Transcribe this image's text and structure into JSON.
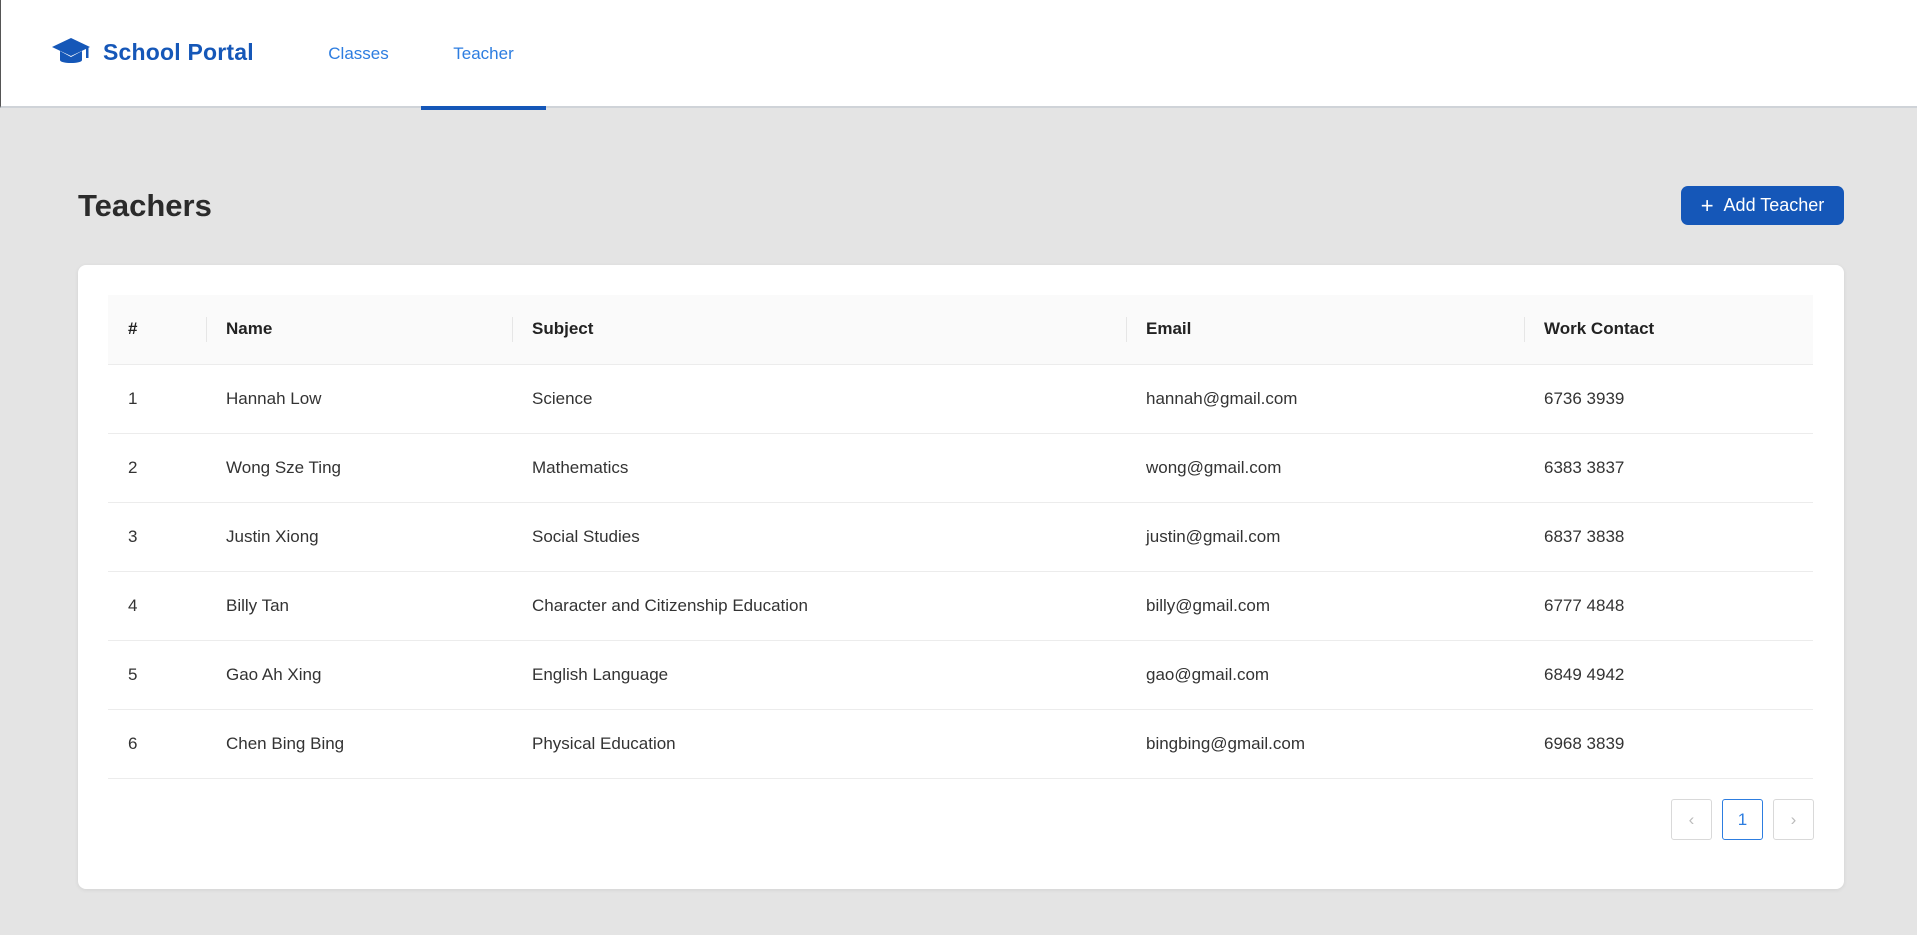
{
  "header": {
    "brand": "School Portal",
    "nav": [
      {
        "label": "Classes",
        "active": false
      },
      {
        "label": "Teacher",
        "active": true
      }
    ]
  },
  "page": {
    "title": "Teachers",
    "add_button_label": "Add Teacher"
  },
  "table": {
    "columns": [
      "#",
      "Name",
      "Subject",
      "Email",
      "Work Contact"
    ],
    "rows": [
      [
        "1",
        "Hannah Low",
        "Science",
        "hannah@gmail.com",
        "6736 3939"
      ],
      [
        "2",
        "Wong Sze Ting",
        "Mathematics",
        "wong@gmail.com",
        "6383 3837"
      ],
      [
        "3",
        "Justin Xiong",
        "Social Studies",
        "justin@gmail.com",
        "6837 3838"
      ],
      [
        "4",
        "Billy Tan",
        "Character and Citizenship Education",
        "billy@gmail.com",
        "6777 4848"
      ],
      [
        "5",
        "Gao Ah Xing",
        "English Language",
        "gao@gmail.com",
        "6849 4942"
      ],
      [
        "6",
        "Chen Bing Bing",
        "Physical Education",
        "bingbing@gmail.com",
        "6968 3839"
      ]
    ]
  },
  "pagination": {
    "prev_icon": "‹",
    "current_page": "1",
    "next_icon": "›"
  },
  "colors": {
    "brand": "#1557b8",
    "link": "#2d7de0",
    "background": "#e4e4e4"
  },
  "icons": {
    "brand": "graduation-cap-icon",
    "add": "plus-icon",
    "prev": "chevron-left-icon",
    "next": "chevron-right-icon"
  }
}
